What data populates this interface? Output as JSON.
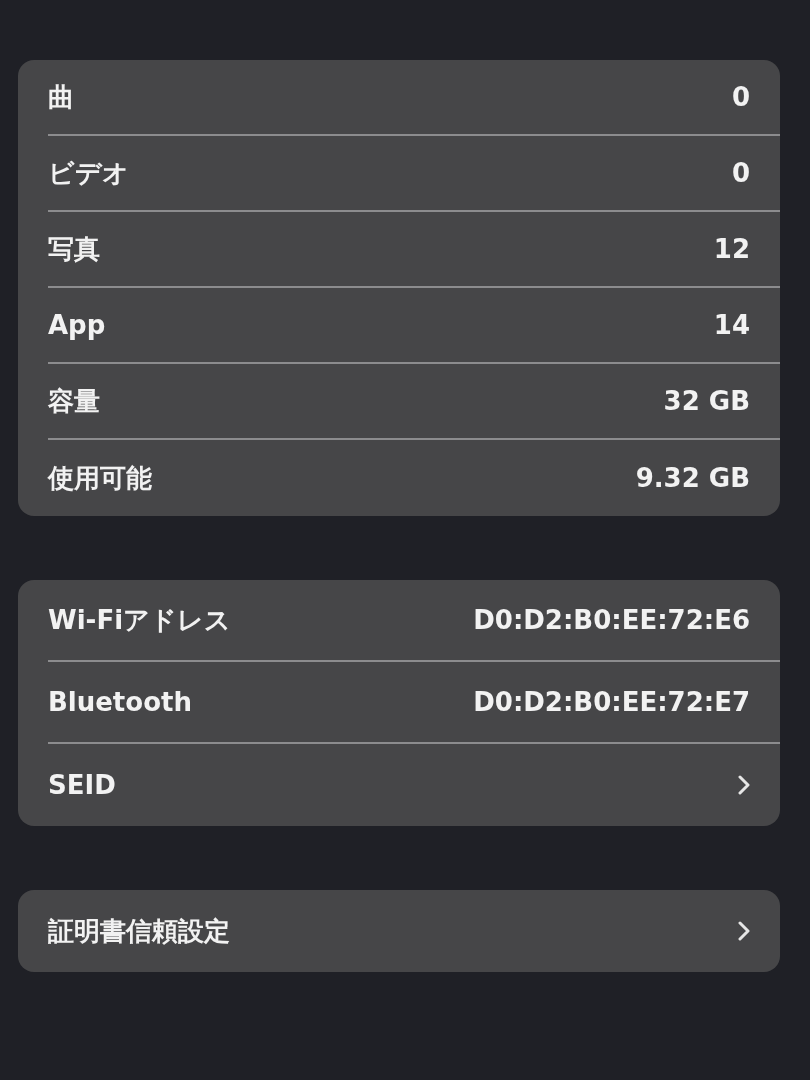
{
  "groups": [
    {
      "rows": [
        {
          "kind": "value",
          "label": "曲",
          "value": "0"
        },
        {
          "kind": "value",
          "label": "ビデオ",
          "value": "0"
        },
        {
          "kind": "value",
          "label": "写真",
          "value": "12"
        },
        {
          "kind": "value",
          "label": "App",
          "value": "14"
        },
        {
          "kind": "value",
          "label": "容量",
          "value": "32 GB"
        },
        {
          "kind": "value",
          "label": "使用可能",
          "value": "9.32 GB"
        }
      ]
    },
    {
      "rows": [
        {
          "kind": "value",
          "label": "Wi-Fiアドレス",
          "value": "D0:D2:B0:EE:72:E6"
        },
        {
          "kind": "value",
          "label": "Bluetooth",
          "value": "D0:D2:B0:EE:72:E7"
        },
        {
          "kind": "link",
          "label": "SEID"
        }
      ]
    },
    {
      "rows": [
        {
          "kind": "link",
          "label": "証明書信頼設定"
        }
      ]
    }
  ]
}
